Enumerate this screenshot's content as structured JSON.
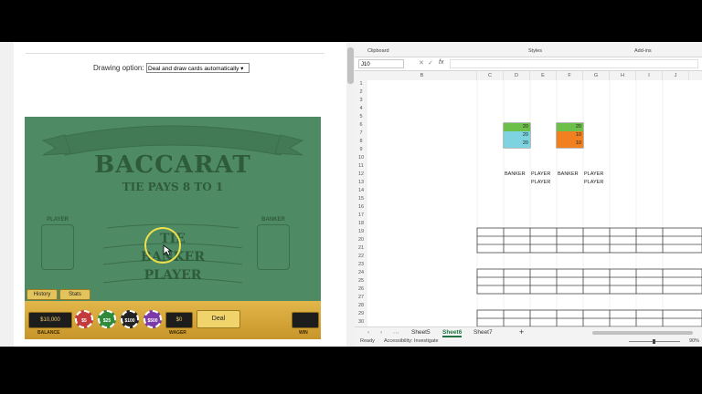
{
  "browser": {
    "drawing_option_label": "Drawing option:",
    "drawing_option_value": "Deal and draw cards automatically"
  },
  "game": {
    "title": "BACCARAT",
    "subtitle": "TIE PAYS 8 TO 1",
    "player_label": "PLAYER",
    "banker_label": "BANKER",
    "bet_tie": "TIE",
    "bet_banker": "BANKER",
    "bet_player": "PLAYER",
    "history_button": "History",
    "stats_button": "Stats",
    "balance_value": "$10,000",
    "balance_label": "BALANCE",
    "chips": [
      "$5",
      "$25",
      "$100",
      "$500"
    ],
    "wager_value": "$0",
    "wager_label": "WAGER",
    "deal_button": "Deal",
    "win_label": "WIN",
    "colors": {
      "felt": "#4e8a63",
      "gold": "#e2b64a"
    }
  },
  "excel": {
    "ribbon_groups": [
      "Clipboard",
      "Styles",
      "Add-ins"
    ],
    "name_box": "J10",
    "fx_label": "fx",
    "columns": [
      "B",
      "C",
      "D",
      "E",
      "F",
      "G",
      "H",
      "I",
      "J"
    ],
    "rows": [
      "1",
      "2",
      "3",
      "4",
      "5",
      "6",
      "7",
      "8",
      "9",
      "10",
      "11",
      "12",
      "13",
      "14",
      "15",
      "16",
      "17",
      "18",
      "19",
      "20",
      "21",
      "22",
      "23",
      "24",
      "25",
      "26",
      "27",
      "28",
      "29",
      "30"
    ],
    "block1": [
      "20",
      "20",
      "20"
    ],
    "block2": [
      "20",
      "10",
      "10"
    ],
    "row12": {
      "d": "BANKER",
      "e": "PLAYER",
      "f": "BANKER",
      "g": "PLAYER"
    },
    "row13": {
      "e": "PLAYER",
      "g": "PLAYER"
    },
    "sheets": [
      "Sheet5",
      "Sheet6",
      "Sheet7"
    ],
    "active_sheet": "Sheet6",
    "status_ready": "Ready",
    "status_accessibility": "Accessibility: Investigate",
    "zoom": "90%"
  }
}
